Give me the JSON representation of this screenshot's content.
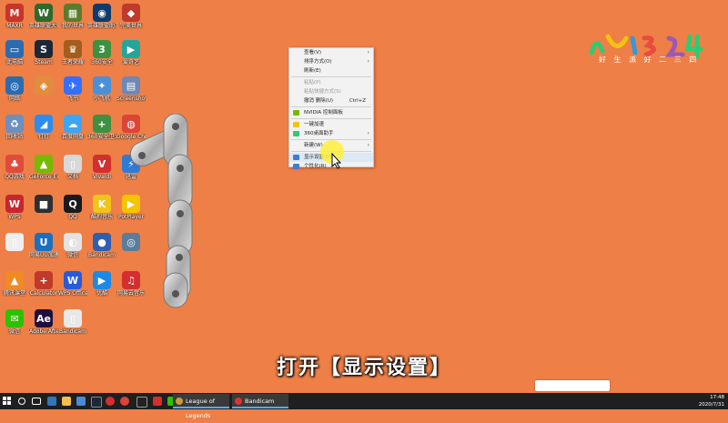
{
  "desktop_icons": [
    {
      "label": "MAXR",
      "color": "#c8342b",
      "glyph": "M"
    },
    {
      "label": "英雄联盟大师",
      "color": "#2e6a2e",
      "glyph": "W"
    },
    {
      "label": "我的世界",
      "color": "#5a7c2d",
      "glyph": "▦"
    },
    {
      "label": "英雄联盟助手",
      "color": "#0e3b6b",
      "glyph": "◉"
    },
    {
      "label": "完美世界",
      "color": "#c0392b",
      "glyph": "◆"
    },
    {
      "label": "此电脑",
      "color": "#2b6cb0",
      "glyph": "▭"
    },
    {
      "label": "Steam",
      "color": "#1b2838",
      "glyph": "S"
    },
    {
      "label": "王者荣耀",
      "color": "#a35d1c",
      "glyph": "♛"
    },
    {
      "label": "360安全",
      "color": "#3d9140",
      "glyph": "3"
    },
    {
      "label": "爱奇艺",
      "color": "#26a69a",
      "glyph": "▶"
    },
    {
      "label": "网络",
      "color": "#2b6cb0",
      "glyph": "◎"
    },
    {
      "label": "",
      "color": "#e08e3d",
      "glyph": "◈"
    },
    {
      "label": "飞书",
      "color": "#3370ff",
      "glyph": "✈"
    },
    {
      "label": "小飞机",
      "color": "#4a90d9",
      "glyph": "✦"
    },
    {
      "label": "Screenshot",
      "color": "#6d88b5",
      "glyph": "▤"
    },
    {
      "label": "回收站",
      "color": "#6b8fbf",
      "glyph": "♻"
    },
    {
      "label": "钉钉",
      "color": "#2d8cf0",
      "glyph": "◢"
    },
    {
      "label": "百度网盘",
      "color": "#3ea5f2",
      "glyph": "☁"
    },
    {
      "label": "360安全卫士",
      "color": "#3d9140",
      "glyph": "+"
    },
    {
      "label": "Google Chrome",
      "color": "#db4437",
      "glyph": "◍"
    },
    {
      "label": "QQ游戏",
      "color": "#e14b3b",
      "glyph": "♣"
    },
    {
      "label": "GeForce Experience",
      "color": "#76b900",
      "glyph": "▲"
    },
    {
      "label": "文档",
      "color": "#d8d8d8",
      "glyph": "▯"
    },
    {
      "label": "Vivaldi",
      "color": "#d32f2f",
      "glyph": "V"
    },
    {
      "label": "迅雷",
      "color": "#2e7bd6",
      "glyph": "⚡"
    },
    {
      "label": "WPS",
      "color": "#c6262e",
      "glyph": "W"
    },
    {
      "label": "",
      "color": "#2f2f2f",
      "glyph": "■"
    },
    {
      "label": "QQ",
      "color": "#1a1a1a",
      "glyph": "Q"
    },
    {
      "label": "酷狗音乐",
      "color": "#f0c419",
      "glyph": "K"
    },
    {
      "label": "PotPlayer",
      "color": "#f5c400",
      "glyph": "▶"
    },
    {
      "label": "",
      "color": "#eeeeee",
      "glyph": "▯"
    },
    {
      "label": "网易UU加速器",
      "color": "#1b6fbf",
      "glyph": "U"
    },
    {
      "label": "微信",
      "color": "#e3e3e3",
      "glyph": "◐"
    },
    {
      "label": "Bandicam",
      "color": "#2f5fb0",
      "glyph": "●"
    },
    {
      "label": "",
      "color": "#5a7d9a",
      "glyph": "◎"
    },
    {
      "label": "腾讯课堂",
      "color": "#f08a24",
      "glyph": "▲"
    },
    {
      "label": "Calculator",
      "color": "#c0392b",
      "glyph": "+"
    },
    {
      "label": "WPS Office",
      "color": "#2a5bd7",
      "glyph": "W"
    },
    {
      "label": "优酷",
      "color": "#1e88e5",
      "glyph": "▶"
    },
    {
      "label": "网易云音乐",
      "color": "#d32f2f",
      "glyph": "♫"
    },
    {
      "label": "微信",
      "color": "#2dc100",
      "glyph": "✉"
    },
    {
      "label": "Adobe After Effects 2020",
      "color": "#1f0f3f",
      "glyph": "Ae"
    },
    {
      "label": "Bandicam",
      "color": "#e8e8e8",
      "glyph": "▯"
    }
  ],
  "context_menu": {
    "items": [
      {
        "label": "查看(V)",
        "arrow": "›",
        "disabled": false
      },
      {
        "label": "排序方式(O)",
        "arrow": "›",
        "disabled": false
      },
      {
        "label": "刷新(E)",
        "disabled": false
      },
      {
        "sep": true
      },
      {
        "label": "粘贴(P)",
        "disabled": true
      },
      {
        "label": "粘贴快捷方式(S)",
        "disabled": true
      },
      {
        "label": "撤消 删除(U)",
        "shortcut": "Ctrl+Z",
        "disabled": false
      },
      {
        "sep": true
      },
      {
        "label": "NVIDIA 控制面板",
        "icon": "#76b900",
        "disabled": false
      },
      {
        "sep": true
      },
      {
        "label": "一键加速",
        "icon": "#f1c40f",
        "disabled": false
      },
      {
        "label": "360桌面助手",
        "icon": "#2ecc71",
        "arrow": "›",
        "disabled": false
      },
      {
        "sep": true
      },
      {
        "label": "新建(W)",
        "arrow": "›",
        "disabled": false
      },
      {
        "sep": true
      },
      {
        "label": "显示设置(D)",
        "icon": "#3b7dd8",
        "disabled": false,
        "hover": true
      },
      {
        "label": "个性化(R)",
        "icon": "#3b7dd8",
        "disabled": false
      }
    ]
  },
  "logo": {
    "text": "好 生 派 好 二 三 四",
    "colors": [
      "#2ecc71",
      "#f1c40f",
      "#e74c3c",
      "#3498db"
    ]
  },
  "subtitle": "打开【显示设置】",
  "taskbar": {
    "apps": [
      {
        "label": "League of Legends",
        "color": "#c89b3c"
      },
      {
        "label": "Bandicam",
        "color": "#d33"
      }
    ],
    "clock_time": "17:48",
    "clock_date": "2020/7/31"
  }
}
